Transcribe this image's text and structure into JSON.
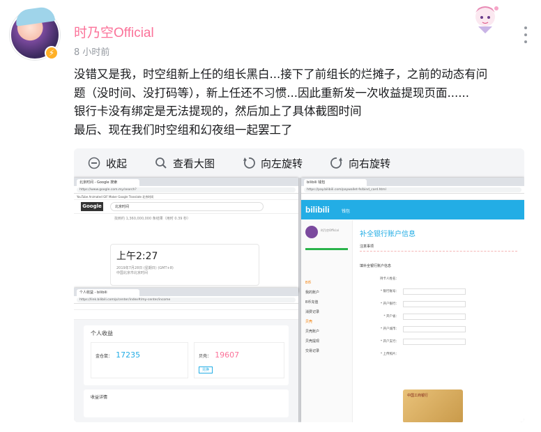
{
  "author": {
    "name": "时乃空Official",
    "time": "8 小时前"
  },
  "post": {
    "lines": [
      "没错又是我，时空组新上任的组长黑白...接下了前组长的烂摊子，之前的动态有问",
      "题（没时间、没打码等），新上任还不习惯...因此重新发一次收益提现页面......",
      "银行卡没有绑定是无法提现的，然后加上了具体截图时间",
      "最后、现在我们时空组和幻夜组一起罢工了"
    ]
  },
  "toolbar": {
    "collapse": "收起",
    "view_large": "查看大图",
    "rotate_left": "向左旋转",
    "rotate_right": "向右旋转"
  },
  "screenshot": {
    "google": {
      "tab": "北京时间 - Google 搜索",
      "url": "https://www.google.com.my/search?",
      "bookmarks": "YouTube   Animated GIF Maker   Google Translate   北京时间",
      "logo": "Google",
      "query": "北京时间",
      "results_note": "找到约 1,360,000,000 条结果（用时 0.39 秒）",
      "clock": "上午2:27",
      "date": "2019年7月28日 (星期日) (GMT+8)",
      "location": "中国北京市北京时间"
    },
    "earnings": {
      "url": "https://link.bilibili.com/p/center/index#/my-center/income",
      "section_title": "个人收益",
      "gold_label": "金仓鼠：",
      "gold_value": "17235",
      "silver_label": "贝壳：",
      "silver_value": "19607",
      "details_title": "收益详情",
      "exchange_button": "兑换"
    },
    "bank": {
      "url": "https://pay.bilibili.com/paywallet-fe/bind_card.html",
      "logo": "bilibili",
      "wallet": "钱包",
      "username": "时乃空Official",
      "page_title": "补全银行账户信息",
      "notice_title": "注意事项",
      "form_title": "填补全银行账户信息",
      "fields": [
        "持卡人姓名：",
        "* 银行账号：",
        "* 开户银行：",
        "* 开户省：",
        "* 开户城市：",
        "* 开户支行：",
        "* 上传照片："
      ],
      "card_text": "中国工商银行",
      "sidebar": [
        "B币",
        "我的账户",
        "B币充值",
        "消费记录",
        "贝壳",
        "贝壳账户",
        "贝壳提现",
        "交易记录"
      ]
    }
  }
}
